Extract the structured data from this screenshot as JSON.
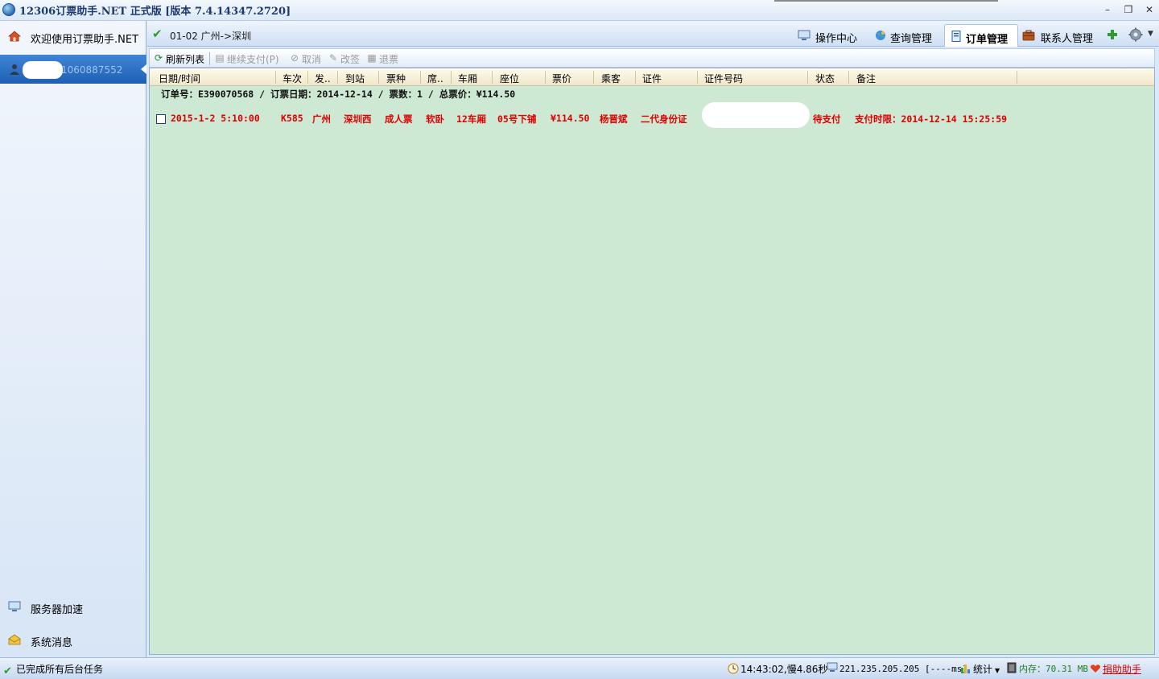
{
  "window": {
    "title": "12306订票助手.NET  正式版 [版本 7.4.14347.2720]",
    "controls": [
      "–",
      "❐",
      "✕"
    ]
  },
  "sidebar": {
    "welcome": "欢迎使用订票助手.NET",
    "account_partial": "1060887552(",
    "server_speedup": "服务器加速",
    "system_messages": "系统消息"
  },
  "topnav": {
    "route": "01-02 广州->深圳",
    "tabs": [
      {
        "label": "操作中心",
        "icon": "monitor-icon"
      },
      {
        "label": "查询管理",
        "icon": "globe-icon"
      },
      {
        "label": "订单管理",
        "icon": "order-book-icon",
        "active": true
      },
      {
        "label": "联系人管理",
        "icon": "briefcase-icon"
      }
    ]
  },
  "toolbar": {
    "refresh": "刷新列表",
    "continue_pay": "继续支付(P)",
    "cancel": "取消",
    "change": "改签",
    "refund": "退票"
  },
  "grid": {
    "columns": [
      "日期/时间",
      "车次",
      "发..",
      "到站",
      "票种",
      "席..",
      "车厢",
      "座位",
      "票价",
      "乘客",
      "证件",
      "证件号码",
      "状态",
      "备注"
    ],
    "order_summary": "订单号：E390070568 / 订票日期：2014-12-14 / 票数：1 / 总票价：¥114.50",
    "rows": [
      {
        "datetime": "2015-1-2 5:10:00",
        "train": "K585",
        "from": "广州",
        "to": "深圳西",
        "ticket_type": "成人票",
        "seat_class": "软卧",
        "coach": "12车厢",
        "seat": "05号下铺",
        "price": "¥114.50",
        "passenger": "杨晋斌",
        "id_type": "二代身份证",
        "status": "待支付",
        "remark": "支付时限：2014-12-14 15:25:59"
      }
    ]
  },
  "statusbar": {
    "task_status": "已完成所有后台任务",
    "time_info": "14:43:02,慢4.86秒",
    "server": "221.235.205.205 [----ms]",
    "stats": "统计",
    "memory": "内存：70.31 MB",
    "donate": "捐助助手"
  }
}
